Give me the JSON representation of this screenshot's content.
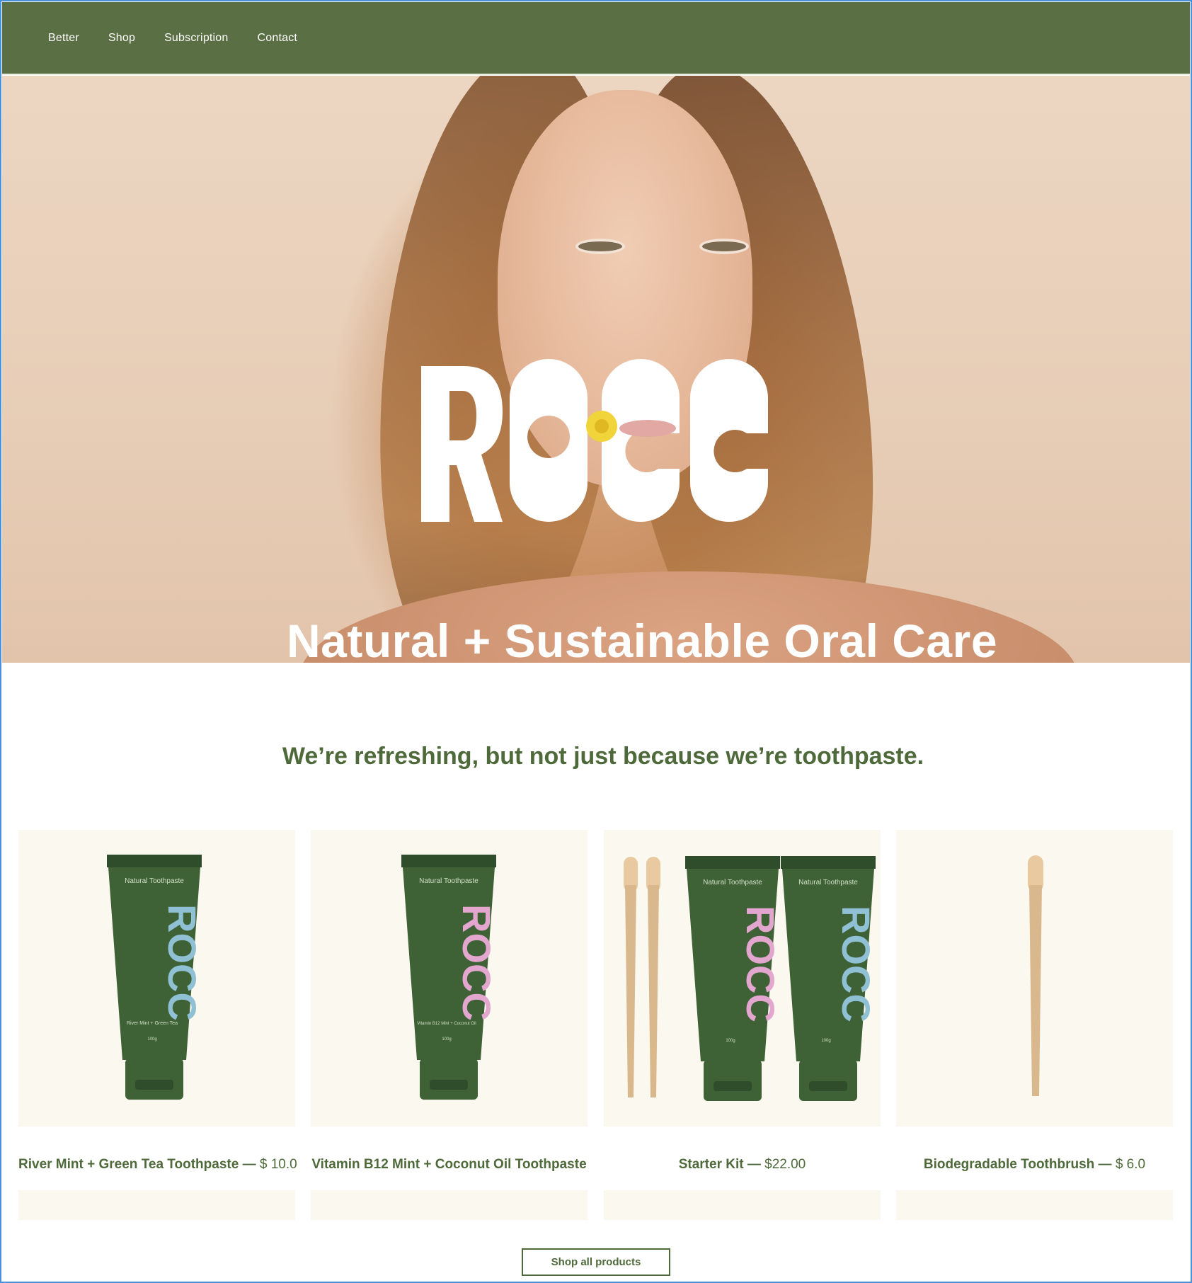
{
  "nav": {
    "items": [
      {
        "label": "Better"
      },
      {
        "label": "Shop"
      },
      {
        "label": "Subscription"
      },
      {
        "label": "Contact"
      }
    ]
  },
  "hero": {
    "logo_text": "ROCC",
    "tagline": "Natural + Sustainable Oral Care"
  },
  "section": {
    "headline": "We’re refreshing, but not just because we’re toothpaste."
  },
  "products": [
    {
      "name": "River Mint + Green Tea Toothpaste",
      "separator": "— ",
      "price": "$ 10.0",
      "tube_label": "Natural Toothpaste",
      "flavor": "River Mint + Green Tea",
      "weight": "100g",
      "accent": "#8fc0d3"
    },
    {
      "name": "Vitamin B12 Mint + Coconut Oil Toothpaste",
      "separator": "",
      "price": "",
      "tube_label": "Natural Toothpaste",
      "flavor": "Vitamin B12 Mint + Coconut Oil",
      "weight": "100g",
      "accent": "#e3a6cf"
    },
    {
      "name": "Starter Kit",
      "separator": "— ",
      "price": "$22.00",
      "tube_label": "Natural Toothpaste",
      "flavor": "",
      "weight": "100g",
      "accent": "#e3a6cf"
    },
    {
      "name": "Biodegradable Toothbrush",
      "separator": "— ",
      "price": "$ 6.0",
      "tube_label": "",
      "flavor": "",
      "weight": "",
      "accent": "#c9a57c"
    }
  ],
  "cta": {
    "label": "Shop all products"
  },
  "colors": {
    "nav_bg": "#5a6f43",
    "brand_green": "#4f6a3a",
    "card_bg": "#fbf9ef",
    "tube_green": "#3f6136"
  }
}
